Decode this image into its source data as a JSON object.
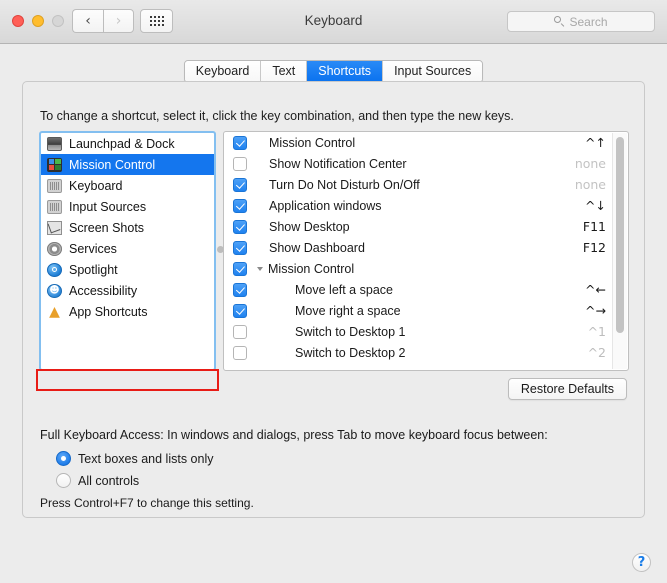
{
  "window": {
    "title": "Keyboard",
    "traffic_lights": [
      "close-button",
      "minimize-button",
      "zoom-button"
    ],
    "back_glyph": "‹",
    "forward_glyph": "›",
    "grid_button_label": "show-all-button"
  },
  "search": {
    "placeholder": "Search",
    "value": ""
  },
  "tabs": [
    {
      "label": "Keyboard",
      "active": false
    },
    {
      "label": "Text",
      "active": false
    },
    {
      "label": "Shortcuts",
      "active": true
    },
    {
      "label": "Input Sources",
      "active": false
    }
  ],
  "main": {
    "instructions": "To change a shortcut, select it, click the key combination, and then type the new keys.",
    "restore_defaults_label": "Restore Defaults"
  },
  "sidebar": {
    "items": [
      {
        "label": "Launchpad & Dock",
        "icon": "launchpad-icon",
        "selected": false
      },
      {
        "label": "Mission Control",
        "icon": "mission-control-icon",
        "selected": true
      },
      {
        "label": "Keyboard",
        "icon": "keyboard-icon",
        "selected": false
      },
      {
        "label": "Input Sources",
        "icon": "input-sources-icon",
        "selected": false
      },
      {
        "label": "Screen Shots",
        "icon": "screen-shots-icon",
        "selected": false
      },
      {
        "label": "Services",
        "icon": "services-gear-icon",
        "selected": false
      },
      {
        "label": "Spotlight",
        "icon": "spotlight-icon",
        "selected": false
      },
      {
        "label": "Accessibility",
        "icon": "accessibility-icon",
        "selected": false
      },
      {
        "label": "App Shortcuts",
        "icon": "app-shortcuts-icon",
        "selected": false
      }
    ],
    "highlight": {
      "target": "App Shortcuts",
      "color": "#e81c16"
    }
  },
  "shortcuts": {
    "rows": [
      {
        "name": "Mission Control",
        "key": "^↑",
        "checked": true,
        "state": "set",
        "indent": "normal",
        "group": false
      },
      {
        "name": "Show Notification Center",
        "key": "none",
        "checked": false,
        "state": "none",
        "indent": "normal",
        "group": false
      },
      {
        "name": "Turn Do Not Disturb On/Off",
        "key": "none",
        "checked": true,
        "state": "none",
        "indent": "normal",
        "group": false
      },
      {
        "name": "Application windows",
        "key": "^↓",
        "checked": true,
        "state": "set",
        "indent": "normal",
        "group": false
      },
      {
        "name": "Show Desktop",
        "key": "F11",
        "checked": true,
        "state": "set",
        "indent": "normal",
        "group": false
      },
      {
        "name": "Show Dashboard",
        "key": "F12",
        "checked": true,
        "state": "set",
        "indent": "normal",
        "group": false
      },
      {
        "name": "Mission Control",
        "key": "",
        "checked": true,
        "state": "set",
        "indent": "group",
        "group": true
      },
      {
        "name": "Move left a space",
        "key": "^←",
        "checked": true,
        "state": "set",
        "indent": "child",
        "group": false
      },
      {
        "name": "Move right a space",
        "key": "^→",
        "checked": true,
        "state": "set",
        "indent": "child",
        "group": false
      },
      {
        "name": "Switch to Desktop 1",
        "key": "^1",
        "checked": false,
        "state": "dim",
        "indent": "child",
        "group": false
      },
      {
        "name": "Switch to Desktop 2",
        "key": "^2",
        "checked": false,
        "state": "dim",
        "indent": "child",
        "group": false
      }
    ]
  },
  "full_keyboard_access": {
    "label": "Full Keyboard Access: In windows and dialogs, press Tab to move keyboard focus between:",
    "options": [
      {
        "label": "Text boxes and lists only",
        "selected": true
      },
      {
        "label": "All controls",
        "selected": false
      }
    ],
    "hint": "Press Control+F7 to change this setting."
  },
  "help": {
    "glyph": "?"
  }
}
